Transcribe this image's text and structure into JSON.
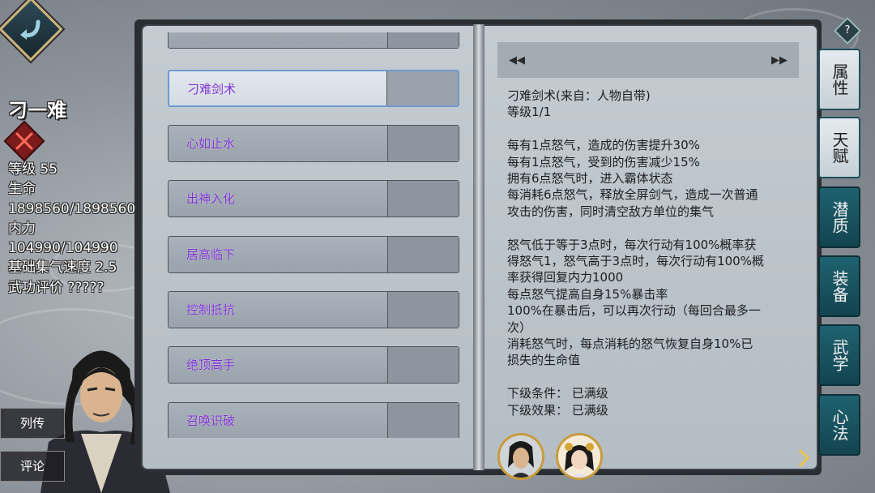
{
  "character": {
    "name": "刁一难",
    "stats": [
      "等级 55",
      "生命",
      "1898560/1898560",
      "内力",
      "104990/104990",
      "基础集气速度 2.5",
      "武功评价 ?????"
    ]
  },
  "side_buttons": {
    "biography": "列传",
    "comment": "评论"
  },
  "skills": [
    {
      "label": "刁难剑术",
      "selected": true
    },
    {
      "label": "心如止水",
      "selected": false
    },
    {
      "label": "出神入化",
      "selected": false
    },
    {
      "label": "居高临下",
      "selected": false
    },
    {
      "label": "控制抵抗",
      "selected": false
    },
    {
      "label": "绝顶高手",
      "selected": false
    },
    {
      "label": "召唤识破",
      "selected": false
    }
  ],
  "detail": {
    "lines": [
      "刁难剑术(来自：人物自带)",
      "等级1/1",
      "",
      "每有1点怒气，造成的伤害提升30%",
      "每有1点怒气，受到的伤害减少15%",
      "拥有6点怒气时，进入霸体状态",
      "每消耗6点怒气，释放全屏剑气，造成一次普通",
      "攻击的伤害，同时清空敌方单位的集气",
      "",
      "怒气低于等于3点时，每次行动有100%概率获",
      "得怒气1，怒气高于3点时，每次行动有100%概",
      "率获得回复内力1000",
      "每点怒气提高自身15%暴击率",
      "100%在暴击后，可以再次行动（每回合最多一",
      "次）",
      "消耗怒气时，每点消耗的怒气恢复自身10%已",
      "损失的生命值",
      "",
      "下级条件：  已满级",
      "下级效果：  已满级"
    ]
  },
  "tabs": [
    {
      "label": "属性",
      "active": true
    },
    {
      "label": "天赋",
      "active": true
    },
    {
      "label": "潜质",
      "active": false
    },
    {
      "label": "装备",
      "active": false
    },
    {
      "label": "武学",
      "active": false
    },
    {
      "label": "心法",
      "active": false
    }
  ],
  "help": "?"
}
